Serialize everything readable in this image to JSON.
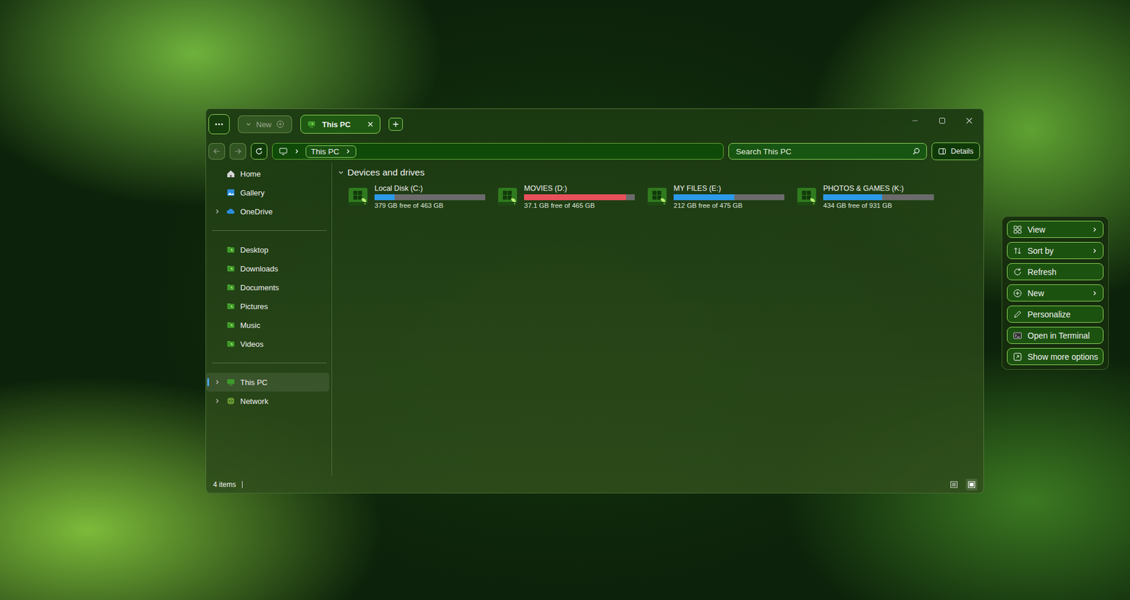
{
  "window": {
    "new_button": {
      "label": "New",
      "disabled": true
    },
    "tabs": [
      {
        "label": "This PC",
        "selected": true
      }
    ]
  },
  "nav": {
    "back_disabled": true,
    "forward_disabled": true
  },
  "address": {
    "crumbs": [
      "This PC"
    ]
  },
  "search": {
    "placeholder": "Search This PC"
  },
  "details_button": {
    "label": "Details"
  },
  "sidebar": {
    "sections": [
      {
        "items": [
          {
            "label": "Home",
            "expandable": false,
            "expanded": false,
            "selected": false
          },
          {
            "label": "Gallery",
            "expandable": false,
            "expanded": false,
            "selected": false
          },
          {
            "label": "OneDrive",
            "expandable": true,
            "expanded": false,
            "selected": false
          }
        ]
      },
      {
        "items": [
          {
            "label": "Desktop",
            "expandable": false,
            "expanded": false,
            "selected": false
          },
          {
            "label": "Downloads",
            "expandable": false,
            "expanded": false,
            "selected": false
          },
          {
            "label": "Documents",
            "expandable": false,
            "expanded": false,
            "selected": false
          },
          {
            "label": "Pictures",
            "expandable": false,
            "expanded": false,
            "selected": false
          },
          {
            "label": "Music",
            "expandable": false,
            "expanded": false,
            "selected": false
          },
          {
            "label": "Videos",
            "expandable": false,
            "expanded": false,
            "selected": false
          }
        ]
      },
      {
        "items": [
          {
            "label": "This PC",
            "expandable": true,
            "expanded": false,
            "selected": true
          },
          {
            "label": "Network",
            "expandable": true,
            "expanded": false,
            "selected": false
          }
        ]
      }
    ]
  },
  "content": {
    "group": {
      "title": "Devices and drives",
      "expanded": true
    },
    "drives": [
      {
        "name": "Local Disk (C:)",
        "free": "379 GB free of 463 GB",
        "level": 0.18,
        "color": "#2b9ae8"
      },
      {
        "name": "MOVIES (D:)",
        "free": "37.1 GB free of 465 GB",
        "level": 0.92,
        "color": "#e8505b"
      },
      {
        "name": "MY FILES (E:)",
        "free": "212 GB free of 475 GB",
        "level": 0.55,
        "color": "#2b9ae8"
      },
      {
        "name": "PHOTOS & GAMES (K:)",
        "free": "434 GB free of 931 GB",
        "level": 0.53,
        "color": "#2b9ae8"
      }
    ]
  },
  "status_bar": {
    "count": "4 items",
    "view_modes": [
      {
        "kind": "details",
        "selected": false
      },
      {
        "kind": "tiles",
        "selected": true
      }
    ]
  },
  "context_menu": {
    "items": [
      {
        "label": "View",
        "submenu": true
      },
      {
        "label": "Sort by",
        "submenu": true
      },
      {
        "label": "Refresh",
        "submenu": false
      },
      {
        "label": "New",
        "submenu": true
      },
      {
        "label": "Personalize",
        "submenu": false
      },
      {
        "label": "Open in Terminal",
        "submenu": false
      },
      {
        "label": "Show more options",
        "submenu": false
      }
    ]
  }
}
